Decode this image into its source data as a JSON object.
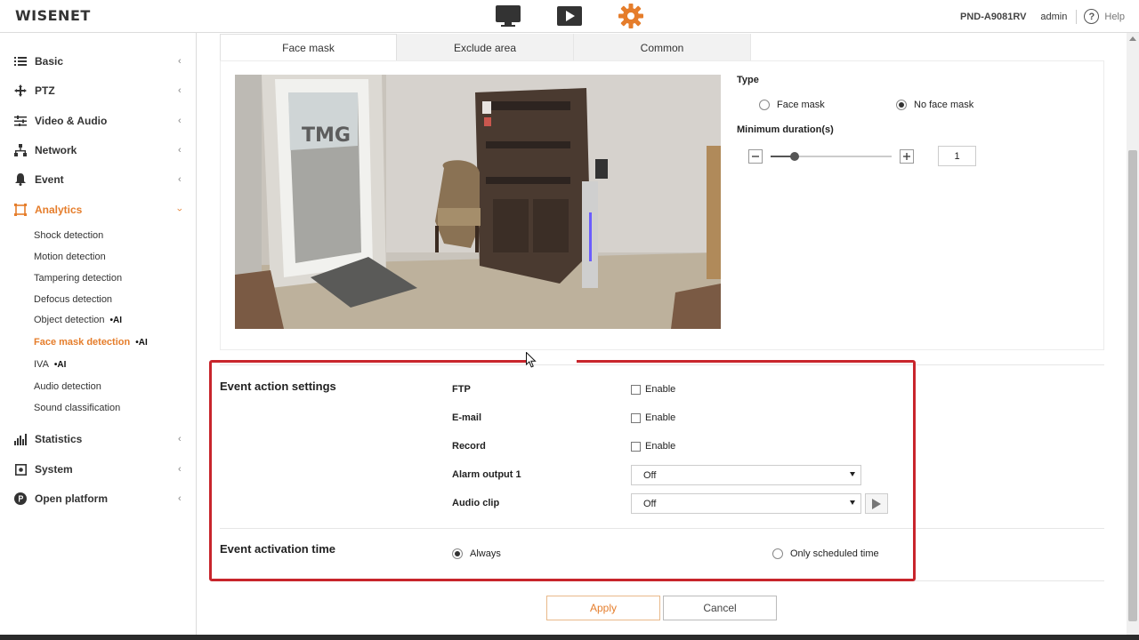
{
  "brand": {
    "logo": "WISENET",
    "accent": "#e57d2b"
  },
  "header": {
    "icons": [
      "monitor-icon",
      "play-icon",
      "gear-icon"
    ],
    "model": "PND-A9081RV",
    "user": "admin",
    "help_label": "Help"
  },
  "sidebar": {
    "items": [
      {
        "label": "Basic",
        "icon": "list-icon"
      },
      {
        "label": "PTZ",
        "icon": "move-arrows-icon"
      },
      {
        "label": "Video & Audio",
        "icon": "sliders-icon"
      },
      {
        "label": "Network",
        "icon": "network-icon"
      },
      {
        "label": "Event",
        "icon": "bell-icon"
      },
      {
        "label": "Analytics",
        "icon": "analytics-frame-icon",
        "active": true
      },
      {
        "label": "Statistics",
        "icon": "bar-chart-icon"
      },
      {
        "label": "System",
        "icon": "system-icon"
      },
      {
        "label": "Open platform",
        "icon": "open-platform-icon"
      }
    ],
    "analytics_sub": [
      {
        "label": "Shock detection"
      },
      {
        "label": "Motion detection"
      },
      {
        "label": "Tampering detection"
      },
      {
        "label": "Defocus detection"
      },
      {
        "label": "Object detection",
        "tag": "•AI"
      },
      {
        "label": "Face mask detection",
        "tag": "•AI",
        "active": true
      },
      {
        "label": "IVA",
        "tag": "•AI"
      },
      {
        "label": "Audio detection"
      },
      {
        "label": "Sound classification"
      }
    ]
  },
  "tabs": [
    {
      "label": "Face mask",
      "active": true
    },
    {
      "label": "Exclude area"
    },
    {
      "label": "Common"
    }
  ],
  "settings": {
    "type_label": "Type",
    "type_options": [
      {
        "label": "Face mask",
        "selected": false
      },
      {
        "label": "No face mask",
        "selected": true
      }
    ],
    "min_duration_label": "Minimum duration(s)",
    "min_duration_value": "1",
    "slider_level_fraction": 0.2
  },
  "event_action": {
    "title": "Event action settings",
    "ftp_label": "FTP",
    "email_label": "E-mail",
    "record_label": "Record",
    "enable_label": "Enable",
    "alarm_label": "Alarm output 1",
    "alarm_value": "Off",
    "audio_label": "Audio clip",
    "audio_value": "Off"
  },
  "activation": {
    "title": "Event activation time",
    "always_label": "Always",
    "always_selected": true,
    "scheduled_label": "Only scheduled time",
    "scheduled_selected": false
  },
  "buttons": {
    "apply": "Apply",
    "cancel": "Cancel"
  },
  "highlight_color": "#c8252c"
}
